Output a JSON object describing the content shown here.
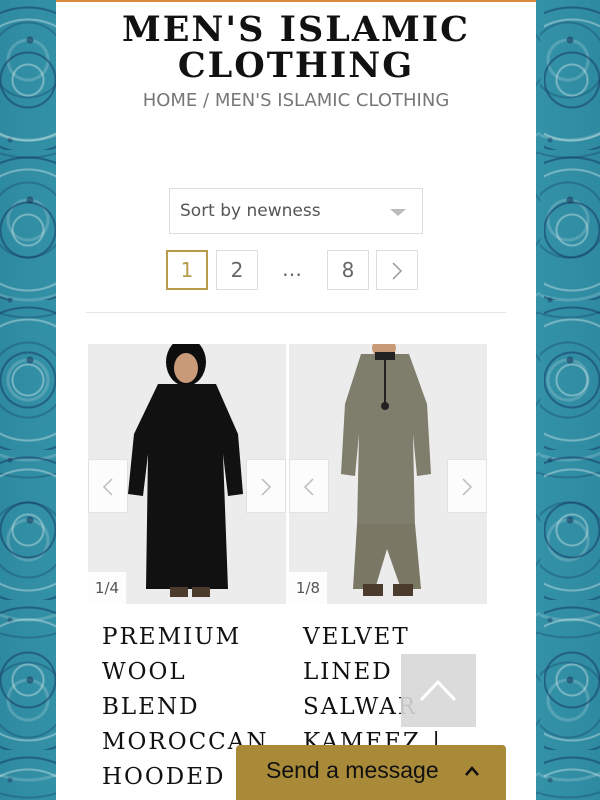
{
  "header": {
    "title_line1": "MEN'S ISLAMIC",
    "title_line2": "CLOTHING",
    "breadcrumb": "HOME / MEN'S ISLAMIC CLOTHING"
  },
  "sort": {
    "selected": "Sort by newness"
  },
  "pagination": {
    "pages": [
      "1",
      "2",
      "…",
      "8"
    ],
    "active": "1"
  },
  "products": [
    {
      "counter": "1/4",
      "name": "PREMIUM WOOL BLEND MOROCCAN HOODED",
      "garment_color": "#111111"
    },
    {
      "counter": "1/8",
      "name": "VELVET LINED SALWAR KAMEEZ |",
      "garment_color": "#7f7d6b"
    }
  ],
  "widgets": {
    "message_label": "Send a message"
  },
  "colors": {
    "accent": "#a88a38",
    "active_page": "#b89a4a",
    "top_border": "#d98a3a"
  }
}
